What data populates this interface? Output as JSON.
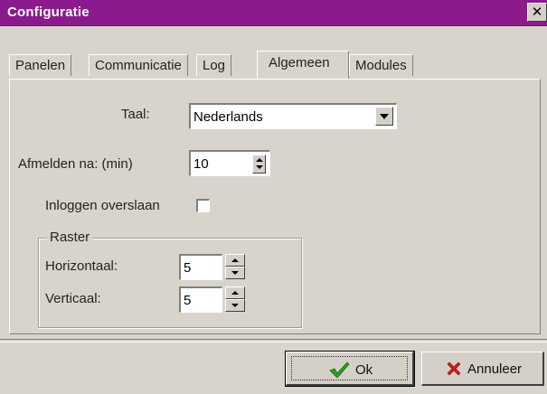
{
  "window": {
    "title": "Configuratie",
    "close_glyph": "✕"
  },
  "tabs": [
    {
      "label": "Panelen",
      "active": false
    },
    {
      "label": "Communicatie",
      "active": false
    },
    {
      "label": "Log",
      "active": false
    },
    {
      "label": "Algemeen",
      "active": true
    },
    {
      "label": "Modules",
      "active": false
    }
  ],
  "general": {
    "language_label": "Taal:",
    "language_value": "Nederlands",
    "logout_label": "Afmelden na: (min)",
    "logout_value": "10",
    "skip_login_label": "Inloggen overslaan",
    "skip_login_checked": false
  },
  "grid": {
    "title": "Raster",
    "horizontal_label": "Horizontaal:",
    "horizontal_value": "5",
    "vertical_label": "Verticaal:",
    "vertical_value": "5"
  },
  "buttons": {
    "ok_label": "Ok",
    "cancel_label": "Annuleer"
  },
  "colors": {
    "titlebar": "#8b1a8c",
    "dialog_bg": "#d8d4cc",
    "ok_check": "#2e9d1c",
    "cancel_x": "#d01818"
  },
  "icons": {
    "ok": "check-icon",
    "cancel": "cross-icon",
    "close": "close-icon",
    "dropdown": "chevron-down-icon",
    "spin": "spin-arrows-icon"
  }
}
